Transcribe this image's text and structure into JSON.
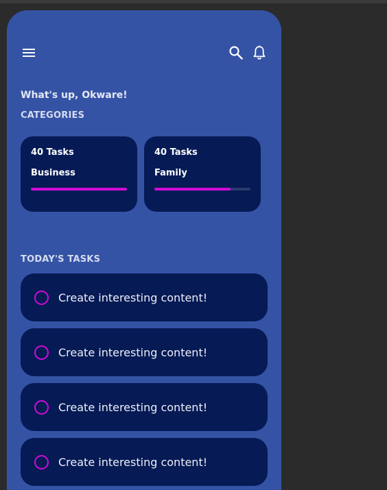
{
  "icons": {
    "menu": "menu-icon",
    "search": "search-icon",
    "notifications": "bell-icon"
  },
  "header": {
    "greeting": "What's up, Okware!"
  },
  "categories": {
    "label": "CATEGORIES",
    "items": [
      {
        "count_label": "40 Tasks",
        "name": "Business",
        "progress": 1.0
      },
      {
        "count_label": "40 Tasks",
        "name": "Family",
        "progress": 0.79
      }
    ]
  },
  "tasks": {
    "label": "TODAY'S TASKS",
    "items": [
      {
        "text": "Create interesting content!",
        "done": false
      },
      {
        "text": "Create interesting content!",
        "done": false
      },
      {
        "text": "Create interesting content!",
        "done": false
      },
      {
        "text": "Create interesting content!",
        "done": false
      }
    ]
  },
  "colors": {
    "background": "#2b2b2b",
    "phone": "#3553a5",
    "card": "#061a55",
    "accent": "#d20cd6"
  }
}
